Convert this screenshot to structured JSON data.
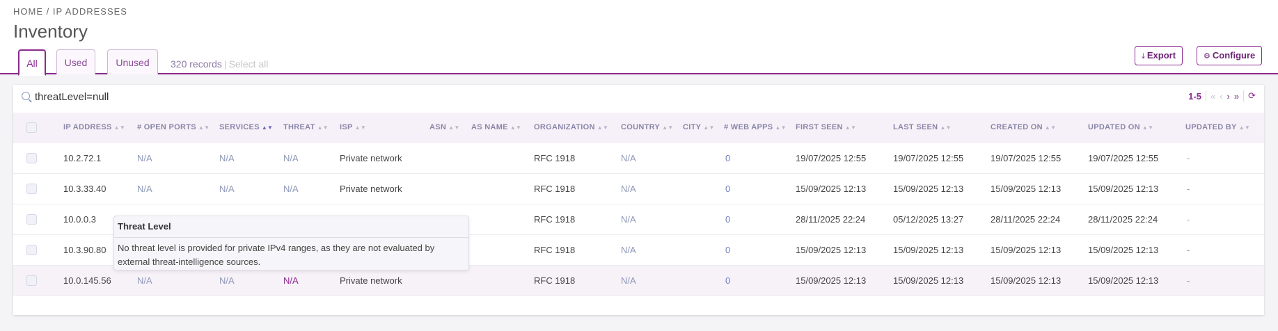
{
  "breadcrumb": {
    "home": "HOME",
    "sep": " / ",
    "current": "IP ADDRESSES"
  },
  "page": {
    "title": "Inventory"
  },
  "tabs": [
    {
      "label": "All",
      "active": true
    },
    {
      "label": "Used",
      "active": false
    },
    {
      "label": "Unused",
      "active": false
    }
  ],
  "records": {
    "count": "320 records",
    "select_all": "Select all"
  },
  "toolbar": {
    "export_label": "Export",
    "configure_label": "Configure"
  },
  "search": {
    "value": "threatLevel=null"
  },
  "pager": {
    "range": "1-5",
    "first": "«",
    "prev": "‹",
    "next": "›",
    "last": "»"
  },
  "columns": [
    "IP ADDRESS",
    "# OPEN PORTS",
    "SERVICES",
    "THREAT",
    "ISP",
    "ASN",
    "AS NAME",
    "ORGANIZATION",
    "COUNTRY",
    "CITY",
    "# WEB APPS",
    "FIRST SEEN",
    "LAST SEEN",
    "CREATED ON",
    "UPDATED ON",
    "UPDATED BY"
  ],
  "rows": [
    {
      "ip": "10.2.72.1",
      "ports": "N/A",
      "services": "N/A",
      "threat": "N/A",
      "isp": "Private network",
      "asn": "",
      "as_name": "",
      "org": "RFC 1918",
      "country": "N/A",
      "city": "",
      "web_apps": "0",
      "first_seen": "19/07/2025 12:55",
      "last_seen": "19/07/2025 12:55",
      "created_on": "19/07/2025 12:55",
      "updated_on": "19/07/2025 12:55",
      "updated_by": "-"
    },
    {
      "ip": "10.3.33.40",
      "ports": "N/A",
      "services": "N/A",
      "threat": "N/A",
      "isp": "Private network",
      "asn": "",
      "as_name": "",
      "org": "RFC 1918",
      "country": "N/A",
      "city": "",
      "web_apps": "0",
      "first_seen": "15/09/2025 12:13",
      "last_seen": "15/09/2025 12:13",
      "created_on": "15/09/2025 12:13",
      "updated_on": "15/09/2025 12:13",
      "updated_by": "-"
    },
    {
      "ip": "10.0.0.3",
      "ports": "",
      "services": "",
      "threat": "",
      "isp": "",
      "asn": "",
      "as_name": "",
      "org": "RFC 1918",
      "country": "N/A",
      "city": "",
      "web_apps": "0",
      "first_seen": "28/11/2025 22:24",
      "last_seen": "05/12/2025 13:27",
      "created_on": "28/11/2025 22:24",
      "updated_on": "28/11/2025 22:24",
      "updated_by": "-"
    },
    {
      "ip": "10.3.90.80",
      "ports": "",
      "services": "",
      "threat": "",
      "isp": "",
      "asn": "",
      "as_name": "",
      "org": "RFC 1918",
      "country": "N/A",
      "city": "",
      "web_apps": "0",
      "first_seen": "15/09/2025 12:13",
      "last_seen": "15/09/2025 12:13",
      "created_on": "15/09/2025 12:13",
      "updated_on": "15/09/2025 12:13",
      "updated_by": "-"
    },
    {
      "ip": "10.0.145.56",
      "ports": "N/A",
      "services": "N/A",
      "threat": "N/A",
      "isp": "Private network",
      "asn": "",
      "as_name": "",
      "org": "RFC 1918",
      "country": "N/A",
      "city": "",
      "web_apps": "0",
      "first_seen": "15/09/2025 12:13",
      "last_seen": "15/09/2025 12:13",
      "created_on": "15/09/2025 12:13",
      "updated_on": "15/09/2025 12:13",
      "updated_by": "-"
    }
  ],
  "tooltip": {
    "title": "Threat Level",
    "body": "No threat level is provided for private IPv4 ranges, as they are not evaluated by external threat-intelligence sources."
  },
  "colors": {
    "accent": "#8b2a8f",
    "na_text": "#8e99b8",
    "header_bg": "#f6f1f8"
  },
  "icons": {
    "search": "search-icon",
    "export": "download-icon",
    "configure": "gear-icon",
    "refresh": "refresh-icon",
    "sort": "sort-icon"
  }
}
